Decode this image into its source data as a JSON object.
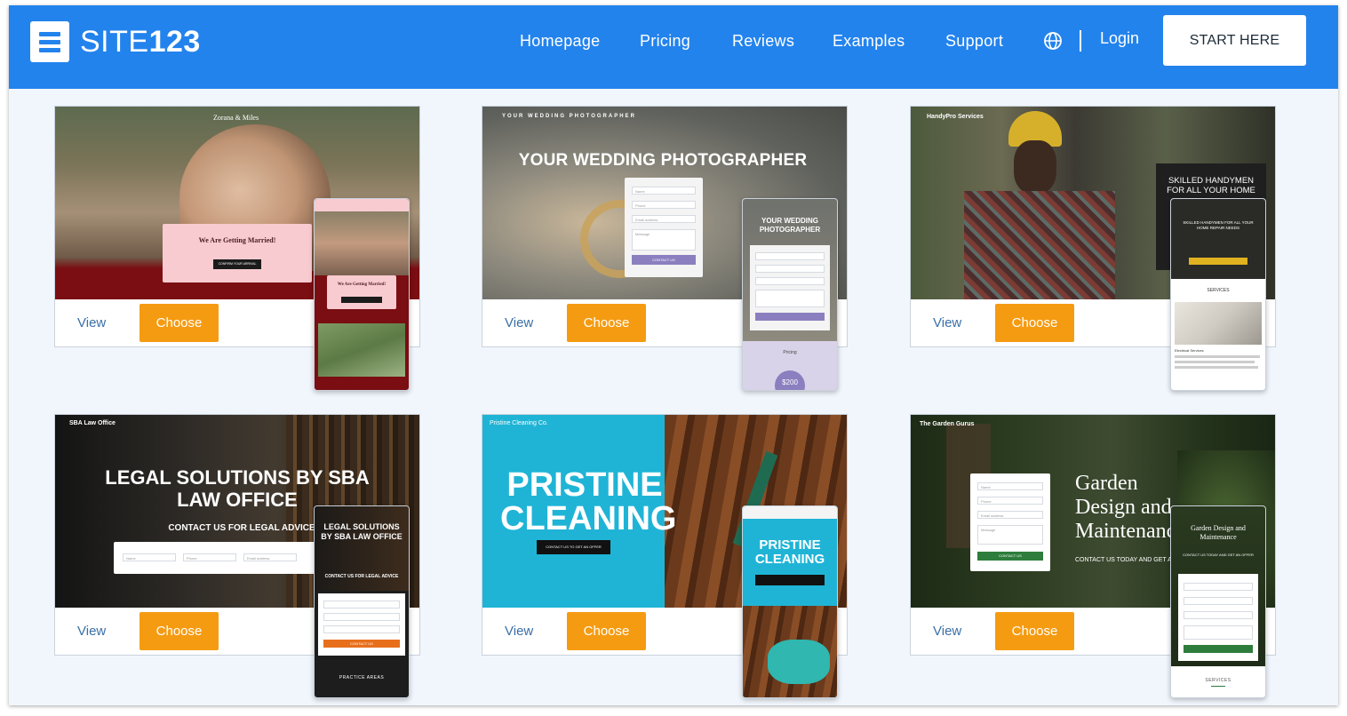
{
  "brand": {
    "name_light": "SITE",
    "name_bold": "123"
  },
  "nav": {
    "items": [
      "Homepage",
      "Pricing",
      "Reviews",
      "Examples",
      "Support"
    ],
    "login": "Login",
    "cta": "START HERE"
  },
  "card_actions": {
    "view": "View",
    "choose": "Choose"
  },
  "templates": [
    {
      "brand": "Zorana & Miles",
      "headline": "We Are Getting Married!",
      "button": "CONFIRM YOUR ARRIVAL"
    },
    {
      "brand": "YOUR WEDDING PHOTOGRAPHER",
      "headline": "YOUR WEDDING PHOTOGRAPHER",
      "submit": "CONTACT US",
      "fields": [
        "Name",
        "Phone",
        "Email address",
        "Message"
      ],
      "pricing_label": "Pricing",
      "price": "$200"
    },
    {
      "brand": "HandyPro Services",
      "headline": "SKILLED HANDYMEN FOR ALL YOUR HOME",
      "mobile_headline": "SKILLED HANDYMEN FOR ALL YOUR HOME REPAIR NEEDS",
      "section": "SERVICES",
      "sub": "Electrical Services"
    },
    {
      "brand": "SBA Law Office",
      "headline": "LEGAL SOLUTIONS BY SBA LAW OFFICE",
      "mobile_headline": "LEGAL SOLUTIONS BY SBA LAW OFFICE",
      "sub": "CONTACT US FOR LEGAL ADVICE",
      "fields": [
        "Name",
        "Phone",
        "Email address"
      ],
      "submit": "CONTACT US",
      "section": "PRACTICE AREAS"
    },
    {
      "brand": "Pristine Cleaning Co.",
      "headline": "PRISTINE CLEANING",
      "button": "CONTACT US TO GET AN OFFER"
    },
    {
      "brand": "The Garden Gurus",
      "headline": "Garden Design and Maintenance",
      "sub": "CONTACT US TODAY AND GET AN OFFER",
      "fields": [
        "Name",
        "Phone",
        "Email address",
        "Message"
      ],
      "submit": "CONTACT US",
      "section": "SERVICES"
    }
  ],
  "colors": {
    "topbar": "#2383ed",
    "choose": "#f59b12",
    "background": "#f1f6fd"
  }
}
